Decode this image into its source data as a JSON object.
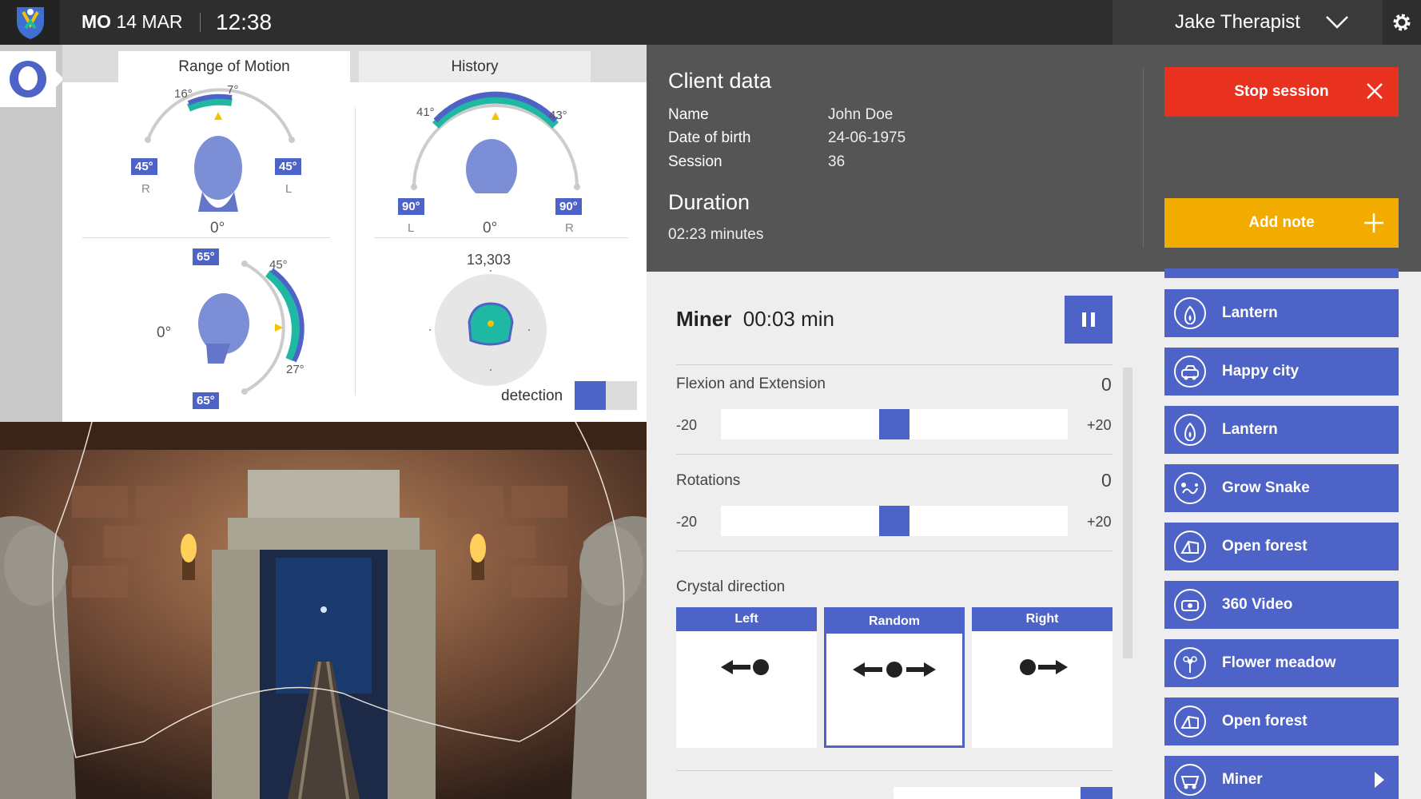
{
  "topbar": {
    "day": "MO",
    "date": "14 MAR",
    "time": "12:38",
    "user": "Jake Therapist"
  },
  "rom": {
    "tabs": [
      "Range of Motion",
      "History"
    ],
    "rotation": {
      "left_angle": "16°",
      "right_angle": "7°",
      "left_limit": "45°",
      "right_limit": "45°",
      "left_side": "R",
      "right_side": "L",
      "center": "0°"
    },
    "history": {
      "left_angle": "41°",
      "right_angle": "43°",
      "left_limit": "90°",
      "right_limit": "90°",
      "left_side": "L",
      "right_side": "R",
      "center": "0°"
    },
    "flexion": {
      "top_limit": "65°",
      "bottom_limit": "65°",
      "up_angle": "45°",
      "down_angle": "27°",
      "center": "0°"
    },
    "heatmap": {
      "count": "13,303"
    },
    "detection_label": "detection",
    "detection_on": true
  },
  "client": {
    "title": "Client data",
    "fields": [
      {
        "label": "Name",
        "value": "John Doe"
      },
      {
        "label": "Date of birth",
        "value": "24-06-1975"
      },
      {
        "label": "Session",
        "value": "36"
      }
    ],
    "duration_title": "Duration",
    "duration_value": "02:23 minutes"
  },
  "actions": {
    "stop": "Stop session",
    "note": "Add note"
  },
  "exercise": {
    "name": "Miner",
    "time": "00:03 min",
    "sliders": [
      {
        "label": "Flexion and Extension",
        "value": "0",
        "min": "-20",
        "max": "+20",
        "level": 0.5
      },
      {
        "label": "Rotations",
        "value": "0",
        "min": "-20",
        "max": "+20",
        "level": 0.5
      }
    ],
    "crystal_title": "Crystal direction",
    "directions": [
      "Left",
      "Random",
      "Right"
    ],
    "selected_direction": "Random"
  },
  "games": [
    {
      "label": "Lantern",
      "icon": "lantern-icon"
    },
    {
      "label": "Happy city",
      "icon": "car-icon"
    },
    {
      "label": "Lantern",
      "icon": "lantern-icon"
    },
    {
      "label": "Grow Snake",
      "icon": "snake-icon"
    },
    {
      "label": "Open forest",
      "icon": "tent-icon"
    },
    {
      "label": "360 Video",
      "icon": "video-360-icon"
    },
    {
      "label": "Flower meadow",
      "icon": "flower-icon"
    },
    {
      "label": "Open forest",
      "icon": "tent-icon"
    },
    {
      "label": "Miner",
      "icon": "minecart-icon"
    }
  ],
  "colors": {
    "accent": "#4e63c7",
    "stop": "#e8311f",
    "note": "#f2ac00",
    "teal": "#1fb8a3"
  }
}
